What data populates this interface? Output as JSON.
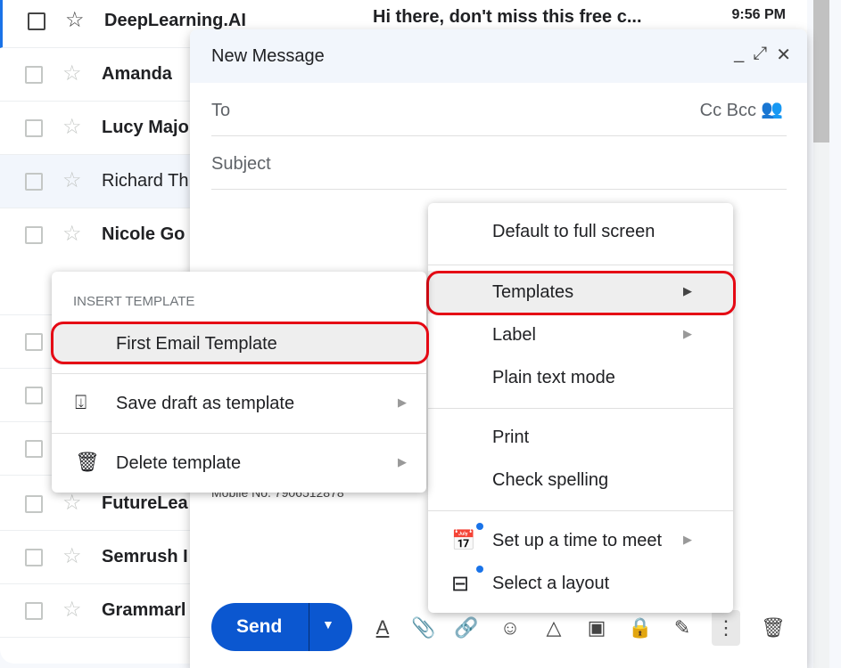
{
  "inbox": {
    "rows": [
      {
        "sender": "DeepLearning.AI",
        "subject": "Hi there, don't miss this free c...",
        "time": "9:56 PM",
        "read": false,
        "selected": true
      },
      {
        "sender": "Amanda",
        "read": false
      },
      {
        "sender": "Lucy Majo",
        "read": false
      },
      {
        "sender": "Richard Th",
        "read": true
      },
      {
        "sender": "Nicole Go",
        "read": false
      },
      {
        "sender": "",
        "read": false
      },
      {
        "sender": "",
        "read": false
      },
      {
        "sender": "",
        "read": false
      },
      {
        "sender": "FutureLea",
        "read": false
      },
      {
        "sender": "Semrush I",
        "read": false
      },
      {
        "sender": "Grammarl",
        "read": false
      }
    ]
  },
  "compose": {
    "title": "New Message",
    "to_label": "To",
    "cc_bcc": "Cc Bcc",
    "subject_placeholder": "Subject",
    "body_partial": "Mobile No. 7906512878",
    "send_label": "Send"
  },
  "more_menu": {
    "items": [
      {
        "label": "Default to full screen"
      },
      {
        "label": "Templates",
        "submenu": true,
        "highlighted": true
      },
      {
        "label": "Label",
        "submenu": true
      },
      {
        "label": "Plain text mode"
      },
      {
        "label": "Print"
      },
      {
        "label": "Check spelling"
      },
      {
        "label": "Set up a time to meet",
        "submenu": true,
        "icon": "calendar-icon"
      },
      {
        "label": "Select a layout",
        "icon": "layout-icon"
      }
    ]
  },
  "templates_menu": {
    "header": "INSERT TEMPLATE",
    "items": [
      {
        "label": "First Email Template",
        "highlighted": true
      },
      {
        "label": "Save draft as template",
        "icon": "save-template-icon",
        "submenu": true
      },
      {
        "label": "Delete template",
        "icon": "trash-icon",
        "submenu": true
      }
    ]
  },
  "colors": {
    "accent": "#0b57d0",
    "highlight_border": "#e50914",
    "notification_dot": "#1a73e8"
  }
}
